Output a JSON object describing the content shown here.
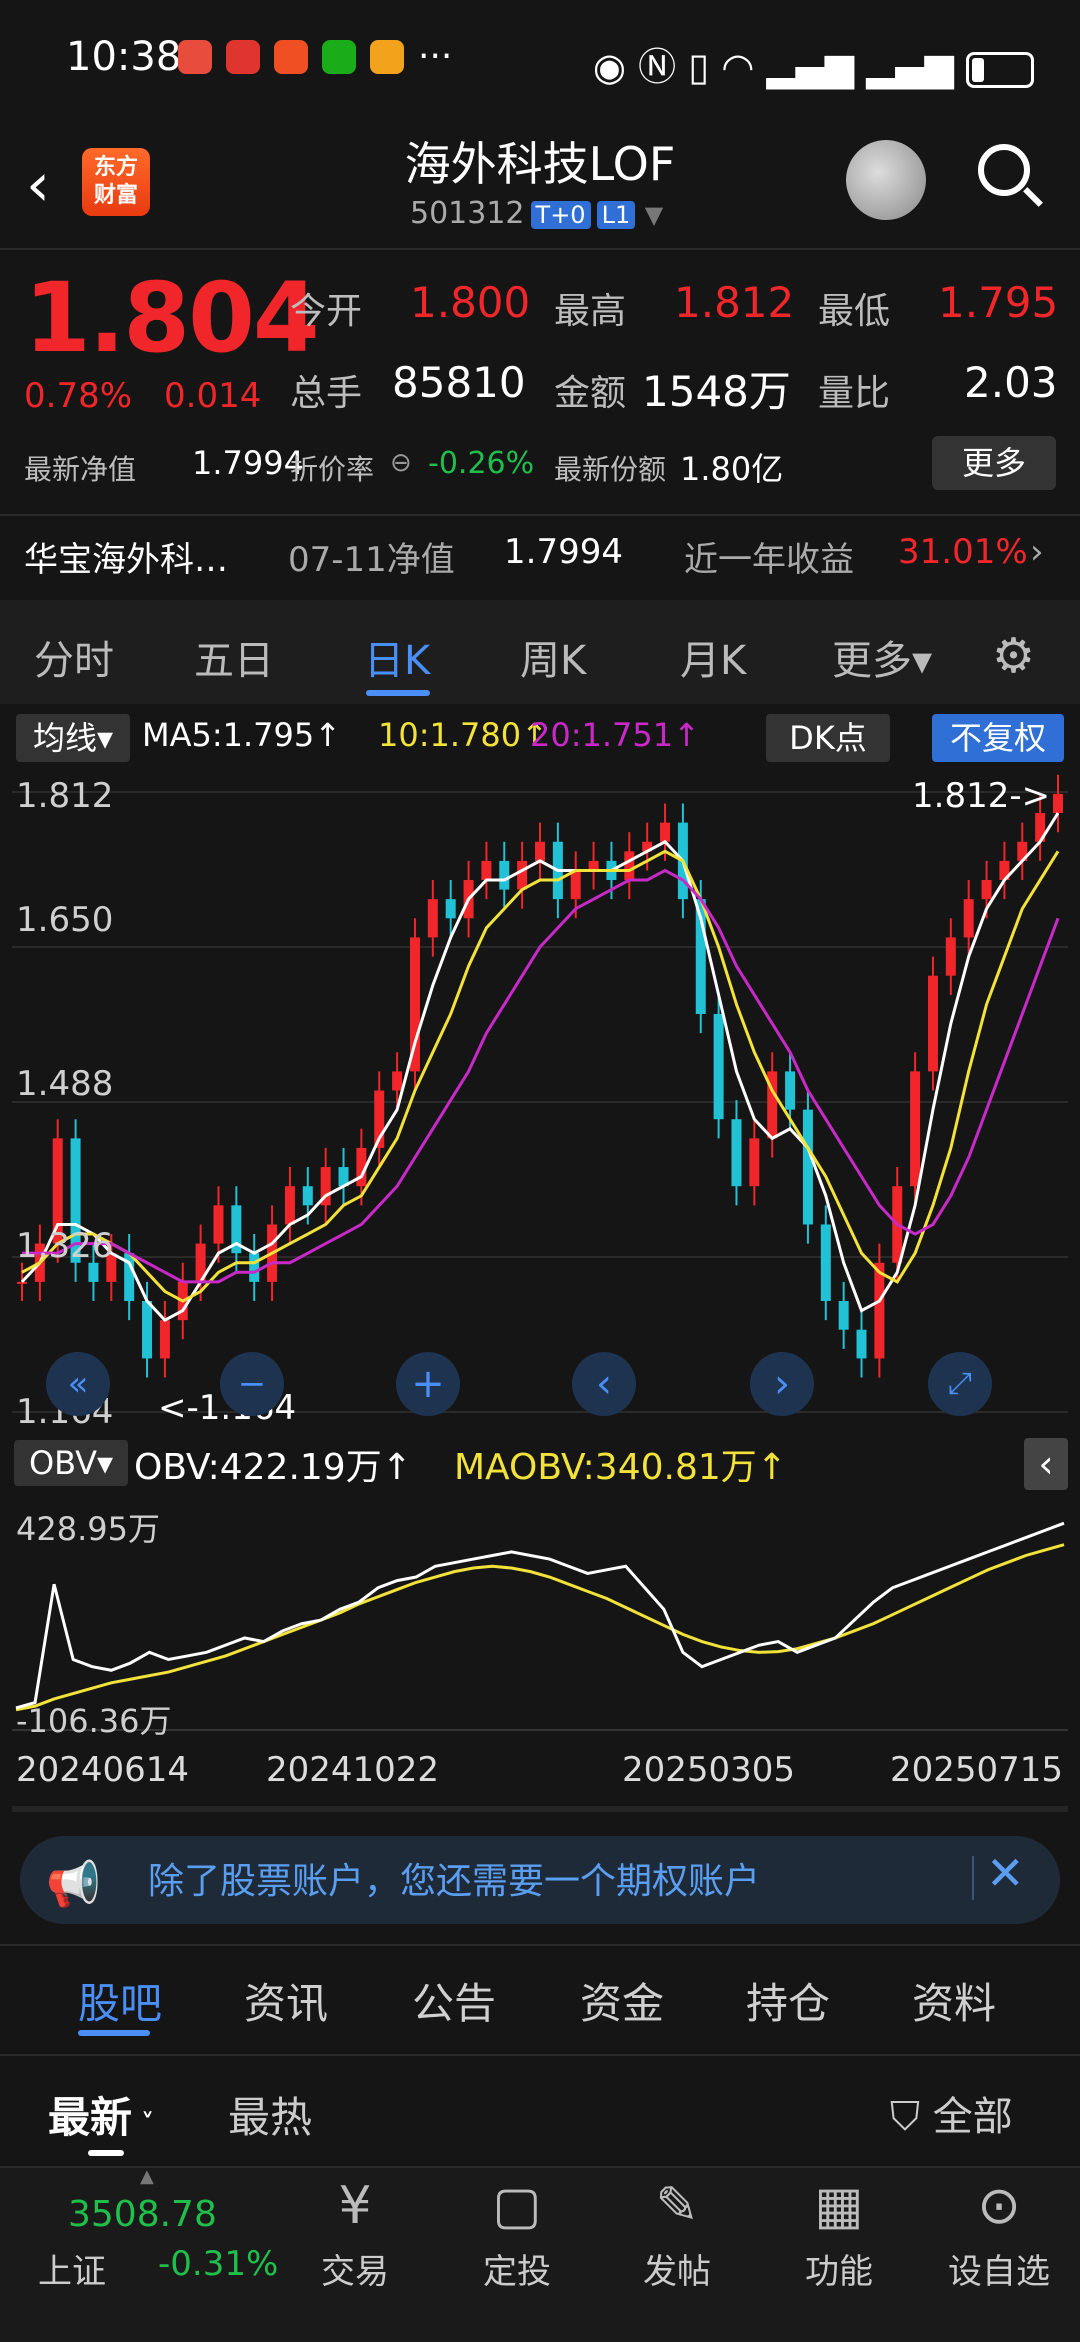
{
  "status_bar": {
    "time": "10:38",
    "dots": "···"
  },
  "header": {
    "title": "海外科技LOF",
    "code": "501312",
    "tag1": "T+0",
    "tag2": "L1",
    "logo": "东方\n财富"
  },
  "quote": {
    "price": "1.804",
    "change_pct": "0.78%",
    "change": "0.014",
    "open_label": "今开",
    "open": "1.800",
    "high_label": "最高",
    "high": "1.812",
    "low_label": "最低",
    "low": "1.795",
    "volume_label": "总手",
    "volume": "85810",
    "amount_label": "金额",
    "amount": "1548万",
    "ratio_label": "量比",
    "ratio": "2.03",
    "nav_label": "最新净值",
    "nav": "1.7994",
    "discount_label": "折价率",
    "discount": "-0.26%",
    "shares_label": "最新份额",
    "shares": "1.80亿",
    "more": "更多"
  },
  "fund": {
    "name": "华宝海外科…",
    "nav_date_label": "07-11净值",
    "nav_value": "1.7994",
    "year_label": "近一年收益",
    "year_return": "31.01%"
  },
  "period_tabs": [
    "分时",
    "五日",
    "日K",
    "周K",
    "月K",
    "更多▾"
  ],
  "indicators": {
    "ma_button": "均线",
    "ma5": "MA5:1.795↑",
    "ma10": "10:1.780↑",
    "ma20": "20:1.751↑",
    "dk": "DK点",
    "adjust": "不复权"
  },
  "chart_data": {
    "type": "line",
    "y_ticks": [
      "1.812",
      "1.650",
      "1.488",
      "1.326",
      "1.164"
    ],
    "ylim": [
      1.164,
      1.812
    ],
    "max_label": "1.812->",
    "min_label": "<-1.164",
    "x_labels": [
      "20240614",
      "20241022",
      "20250305",
      "20250715"
    ],
    "series": [
      {
        "name": "close",
        "values": [
          1.3,
          1.34,
          1.45,
          1.32,
          1.3,
          1.33,
          1.28,
          1.22,
          1.26,
          1.3,
          1.34,
          1.38,
          1.33,
          1.3,
          1.36,
          1.4,
          1.38,
          1.42,
          1.4,
          1.44,
          1.5,
          1.52,
          1.66,
          1.7,
          1.68,
          1.72,
          1.74,
          1.71,
          1.74,
          1.76,
          1.7,
          1.73,
          1.74,
          1.72,
          1.75,
          1.76,
          1.78,
          1.7,
          1.58,
          1.47,
          1.4,
          1.45,
          1.52,
          1.48,
          1.36,
          1.28,
          1.25,
          1.22,
          1.32,
          1.4,
          1.52,
          1.62,
          1.66,
          1.7,
          1.72,
          1.74,
          1.76,
          1.79,
          1.81
        ]
      },
      {
        "name": "MA5",
        "values": [
          1.3,
          1.32,
          1.36,
          1.36,
          1.35,
          1.33,
          1.32,
          1.28,
          1.26,
          1.27,
          1.3,
          1.33,
          1.34,
          1.33,
          1.34,
          1.36,
          1.37,
          1.39,
          1.4,
          1.41,
          1.45,
          1.48,
          1.55,
          1.61,
          1.66,
          1.7,
          1.72,
          1.72,
          1.73,
          1.74,
          1.73,
          1.73,
          1.73,
          1.73,
          1.74,
          1.75,
          1.76,
          1.74,
          1.68,
          1.6,
          1.52,
          1.47,
          1.45,
          1.46,
          1.44,
          1.39,
          1.32,
          1.27,
          1.28,
          1.31,
          1.38,
          1.48,
          1.57,
          1.64,
          1.69,
          1.72,
          1.74,
          1.76,
          1.79
        ]
      },
      {
        "name": "MA10",
        "values": [
          1.31,
          1.32,
          1.34,
          1.35,
          1.35,
          1.34,
          1.33,
          1.31,
          1.29,
          1.28,
          1.29,
          1.31,
          1.32,
          1.32,
          1.33,
          1.34,
          1.35,
          1.36,
          1.38,
          1.39,
          1.42,
          1.45,
          1.5,
          1.54,
          1.58,
          1.63,
          1.67,
          1.69,
          1.71,
          1.72,
          1.72,
          1.73,
          1.73,
          1.73,
          1.73,
          1.74,
          1.75,
          1.74,
          1.7,
          1.65,
          1.59,
          1.54,
          1.5,
          1.47,
          1.44,
          1.41,
          1.37,
          1.33,
          1.31,
          1.3,
          1.33,
          1.38,
          1.44,
          1.52,
          1.59,
          1.64,
          1.69,
          1.72,
          1.75
        ]
      },
      {
        "name": "MA20",
        "values": [
          1.33,
          1.33,
          1.33,
          1.34,
          1.34,
          1.34,
          1.33,
          1.32,
          1.31,
          1.3,
          1.3,
          1.3,
          1.31,
          1.31,
          1.32,
          1.32,
          1.33,
          1.34,
          1.35,
          1.36,
          1.38,
          1.4,
          1.43,
          1.46,
          1.49,
          1.52,
          1.56,
          1.59,
          1.62,
          1.65,
          1.67,
          1.69,
          1.7,
          1.71,
          1.72,
          1.72,
          1.73,
          1.72,
          1.7,
          1.67,
          1.63,
          1.6,
          1.57,
          1.54,
          1.5,
          1.47,
          1.44,
          1.41,
          1.38,
          1.36,
          1.35,
          1.36,
          1.39,
          1.43,
          1.48,
          1.53,
          1.58,
          1.63,
          1.68
        ]
      }
    ],
    "colors": {
      "close": "#ffffff",
      "MA5": "#ffffff",
      "MA10": "#f2e23a",
      "MA20": "#c829c8"
    }
  },
  "obv": {
    "button": "OBV",
    "obv": "OBV:422.19万↑",
    "maobv": "MAOBV:340.81万↑",
    "max": "428.95万",
    "min": "-106.36万",
    "obv_values": [
      -95,
      -80,
      250,
      40,
      20,
      10,
      30,
      60,
      40,
      50,
      60,
      80,
      100,
      90,
      120,
      140,
      150,
      180,
      200,
      240,
      260,
      270,
      300,
      310,
      320,
      330,
      340,
      330,
      320,
      300,
      280,
      290,
      300,
      240,
      180,
      60,
      20,
      40,
      60,
      80,
      90,
      60,
      80,
      100,
      150,
      200,
      240,
      260,
      280,
      300,
      320,
      340,
      360,
      380,
      400,
      420
    ],
    "maobv_values": [
      -100,
      -90,
      -70,
      -55,
      -40,
      -25,
      -15,
      -5,
      5,
      20,
      35,
      50,
      70,
      90,
      110,
      130,
      150,
      170,
      195,
      215,
      235,
      255,
      270,
      285,
      295,
      300,
      295,
      285,
      270,
      250,
      230,
      210,
      185,
      160,
      135,
      110,
      90,
      75,
      65,
      60,
      62,
      70,
      85,
      100,
      120,
      140,
      165,
      190,
      215,
      240,
      265,
      290,
      310,
      330,
      345,
      360
    ],
    "ylim": [
      -106.36,
      428.95
    ]
  },
  "banner": {
    "text": "除了股票账户，您还需要一个期权账户"
  },
  "bottom_tabs": [
    "股吧",
    "资讯",
    "公告",
    "资金",
    "持仓",
    "资料"
  ],
  "sort": {
    "latest": "最新",
    "hot": "最热",
    "filter": "全部"
  },
  "index": {
    "value": "3508.78",
    "name": "上证",
    "change": "-0.31%"
  },
  "nav": [
    {
      "label": "交易",
      "icon": "trade-icon"
    },
    {
      "label": "定投",
      "icon": "invest-icon"
    },
    {
      "label": "发帖",
      "icon": "post-icon"
    },
    {
      "label": "功能",
      "icon": "apps-icon"
    },
    {
      "label": "设自选",
      "icon": "watchlist-icon"
    }
  ]
}
